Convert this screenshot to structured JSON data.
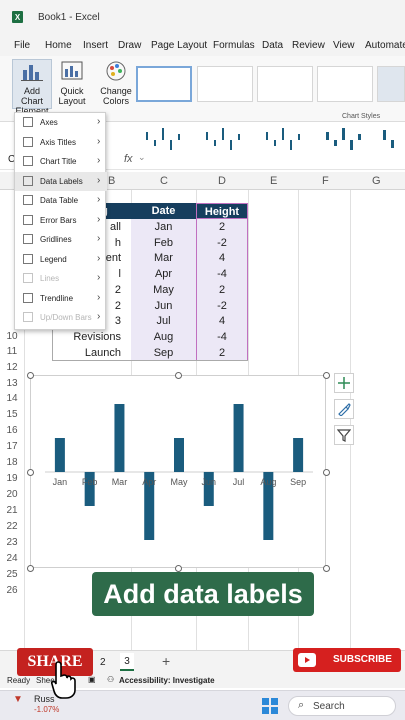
{
  "window": {
    "title": "Book1 - Excel",
    "logo": "X"
  },
  "menu": [
    "File",
    "Home",
    "Insert",
    "Draw",
    "Page Layout",
    "Formulas",
    "Data",
    "Review",
    "View",
    "Automate"
  ],
  "ribbon": {
    "add_chart_element": "Add Chart Element",
    "add_chart_element_l1": "Add Chart",
    "add_chart_element_l2": "Element",
    "quick_layout_l1": "Quick",
    "quick_layout_l2": "Layout",
    "change_colors_l1": "Change",
    "change_colors_l2": "Colors",
    "chart_styles_label": "Chart Styles"
  },
  "formula_bar": {
    "name_box": "C",
    "fx": "fx"
  },
  "dropdown": {
    "items": [
      {
        "label": "Axes",
        "enabled": true
      },
      {
        "label": "Axis Titles",
        "enabled": true
      },
      {
        "label": "Chart Title",
        "enabled": true
      },
      {
        "label": "Data Labels",
        "enabled": true
      },
      {
        "label": "Data Table",
        "enabled": true
      },
      {
        "label": "Error Bars",
        "enabled": true
      },
      {
        "label": "Gridlines",
        "enabled": true
      },
      {
        "label": "Legend",
        "enabled": true
      },
      {
        "label": "Lines",
        "enabled": false
      },
      {
        "label": "Trendline",
        "enabled": true
      },
      {
        "label": "Up/Down Bars",
        "enabled": false
      }
    ]
  },
  "columns": [
    "B",
    "C",
    "D",
    "E",
    "F",
    "G"
  ],
  "rows": [
    "7",
    "8",
    "9",
    "10",
    "11",
    "12",
    "13",
    "14",
    "15",
    "16",
    "17",
    "18",
    "19",
    "20",
    "21",
    "22",
    "23",
    "24",
    "25",
    "26"
  ],
  "table": {
    "header_b": "g",
    "header_date": "Date",
    "header_height": "Height",
    "col_b": [
      "all",
      "h",
      "ent",
      "l",
      "2",
      "2",
      "3",
      "Revisions",
      "Launch"
    ],
    "dates": [
      "Jan",
      "Feb",
      "Mar",
      "Apr",
      "May",
      "Jun",
      "Jul",
      "Aug",
      "Sep"
    ],
    "heights": [
      "2",
      "-2",
      "4",
      "-4",
      "2",
      "-2",
      "4",
      "-4",
      "2"
    ]
  },
  "chart_data": {
    "type": "bar",
    "categories": [
      "Jan",
      "Feb",
      "Mar",
      "Apr",
      "May",
      "Jun",
      "Jul",
      "Aug",
      "Sep"
    ],
    "values": [
      2,
      -2,
      4,
      -4,
      2,
      -2,
      4,
      -4,
      2
    ],
    "title": "",
    "xlabel": "",
    "ylabel": "",
    "ylim": [
      -4,
      4
    ],
    "grid": false,
    "bar_color": "#1a5c7e"
  },
  "caption": "Add data labels",
  "sheet_tabs": [
    "2",
    "3"
  ],
  "status": {
    "ready": "Ready",
    "sheet": "Shee",
    "accessibility": "Accessibility: Investigate"
  },
  "taskbar": {
    "search": "Search",
    "ticker": "Russ",
    "ticker_change": "-1.07%"
  },
  "overlay": {
    "share": "SHARE",
    "subscribe": "SUBSCRIBE"
  },
  "colors": {
    "excel_green": "#1d6f42",
    "header_navy": "#163e5e",
    "selection_purple": "#ece8f6"
  }
}
